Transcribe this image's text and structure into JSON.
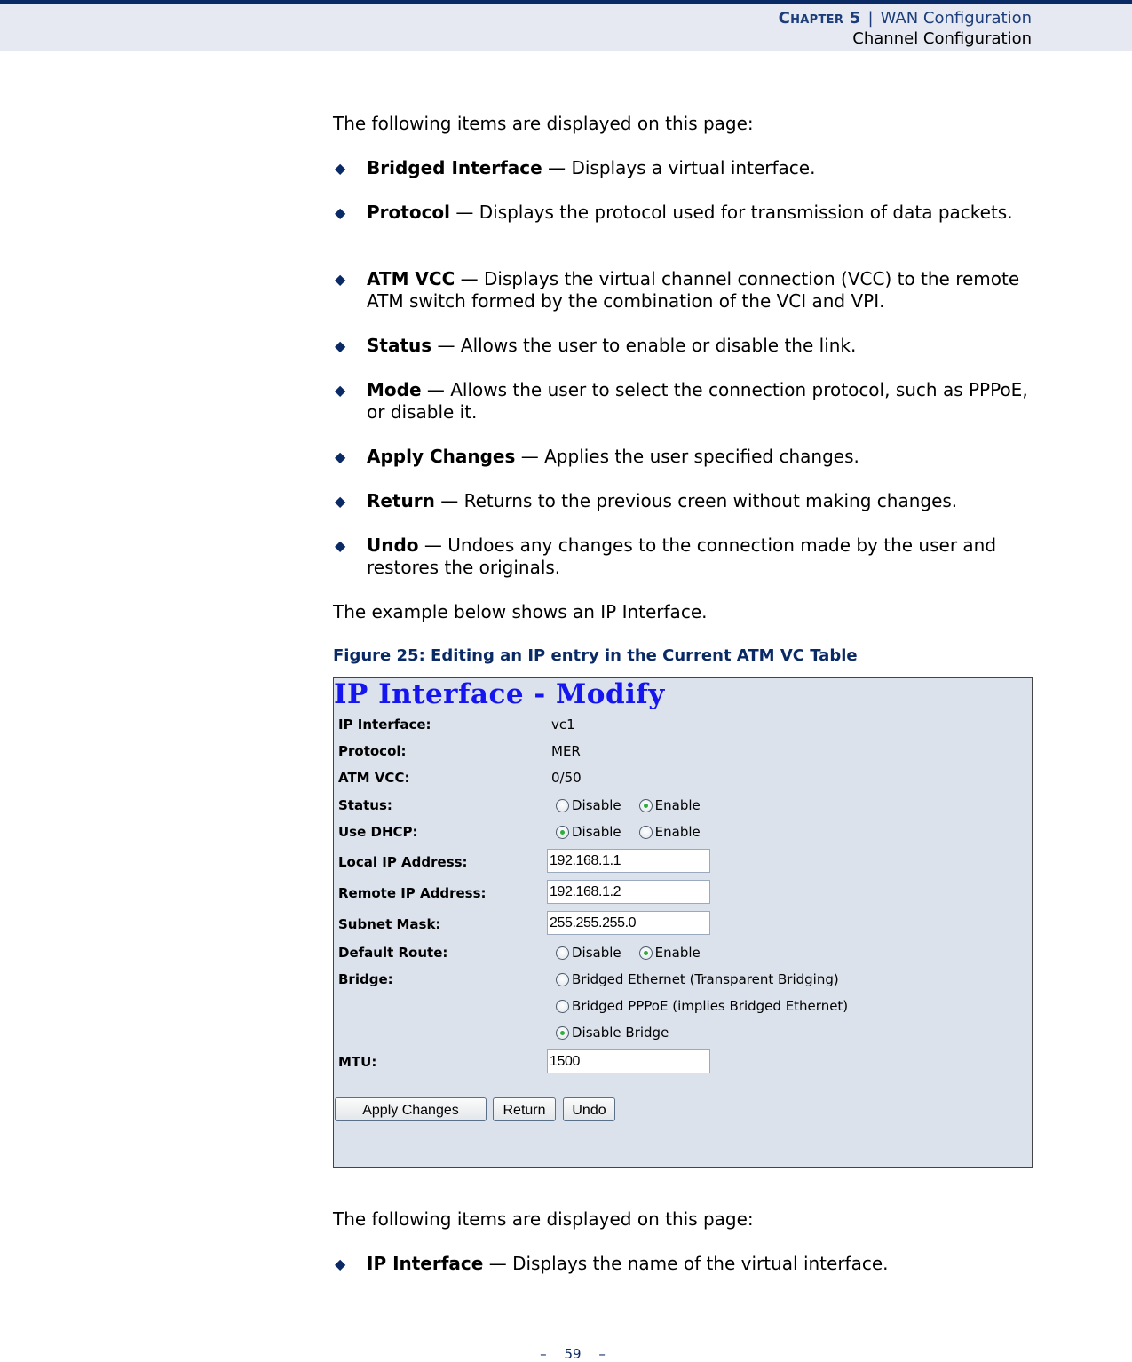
{
  "header": {
    "chapter": "Chapter 5",
    "separator": "|",
    "section": "WAN Configuration",
    "subsection": "Channel Configuration"
  },
  "intro1": "The following items are displayed on this page:",
  "bullets1": [
    {
      "term": "Bridged Interface",
      "desc": " — Displays a virtual interface."
    },
    {
      "term": "Protocol",
      "desc": " — Displays the protocol used for transmission of data packets."
    },
    {
      "term": "ATM VCC",
      "desc": " — Displays the virtual channel connection (VCC) to the remote ATM switch formed by the combination of the VCI and VPI."
    },
    {
      "term": "Status",
      "desc": " — Allows the user to enable or disable the link."
    },
    {
      "term": "Mode",
      "desc": " — Allows the user to select the connection protocol, such as PPPoE, or disable it."
    },
    {
      "term": "Apply Changes",
      "desc": " — Applies the user specified changes."
    },
    {
      "term": "Return",
      "desc": " — Returns to the previous creen without making changes."
    },
    {
      "term": "Undo",
      "desc": " — Undoes any changes to the connection made by the user and restores the originals."
    }
  ],
  "example_text": "The example below shows an IP Interface.",
  "figure_caption": "Figure 25:  Editing an IP entry in the Current ATM VC Table",
  "form": {
    "title": "IP Interface - Modify",
    "ip_interface": {
      "label": "IP Interface:",
      "value": "vc1"
    },
    "protocol": {
      "label": "Protocol:",
      "value": "MER"
    },
    "atm_vcc": {
      "label": "ATM VCC:",
      "value": "0/50"
    },
    "status": {
      "label": "Status:",
      "options": [
        "Disable",
        "Enable"
      ],
      "selected": "Enable"
    },
    "use_dhcp": {
      "label": "Use DHCP:",
      "options": [
        "Disable",
        "Enable"
      ],
      "selected": "Disable"
    },
    "local_ip": {
      "label": "Local IP Address:",
      "value": "192.168.1.1"
    },
    "remote_ip": {
      "label": "Remote IP Address:",
      "value": "192.168.1.2"
    },
    "subnet_mask": {
      "label": "Subnet Mask:",
      "value": "255.255.255.0"
    },
    "default_route": {
      "label": "Default Route:",
      "options": [
        "Disable",
        "Enable"
      ],
      "selected": "Enable"
    },
    "bridge": {
      "label": "Bridge:",
      "options": [
        "Bridged Ethernet (Transparent Bridging)",
        "Bridged PPPoE (implies Bridged Ethernet)",
        "Disable Bridge"
      ],
      "selected": "Disable Bridge"
    },
    "mtu": {
      "label": "MTU:",
      "value": "1500"
    },
    "buttons": {
      "apply": "Apply Changes",
      "return": "Return",
      "undo": "Undo"
    }
  },
  "intro2": "The following items are displayed on this page:",
  "bullets2": [
    {
      "term": "IP Interface",
      "desc": " — Displays the name of the virtual interface."
    }
  ],
  "footer": {
    "page": "59",
    "dash": "–"
  }
}
